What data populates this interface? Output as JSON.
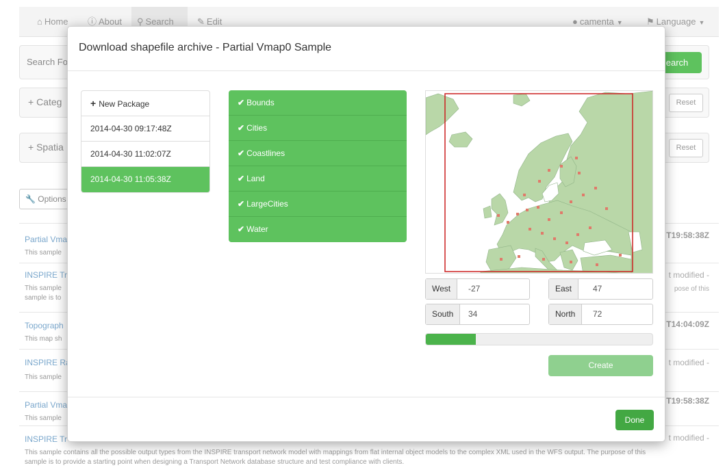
{
  "nav": {
    "home": "Home",
    "about": "About",
    "search": "Search",
    "edit": "Edit",
    "user": "camenta",
    "language": "Language"
  },
  "search": {
    "label": "Search Fo",
    "button": "earch"
  },
  "accordions": [
    {
      "label": "Categ",
      "reset": "Reset"
    },
    {
      "label": "Spatia",
      "reset": "Reset"
    }
  ],
  "options": {
    "label": "Options"
  },
  "results": [
    {
      "title": "Partial Vma",
      "desc": "This sample",
      "meta": "T19:58:38Z"
    },
    {
      "title": "INSPIRE Tr",
      "desc": "This sample\nsample is to",
      "meta": "t modified -",
      "meta2": "pose of this"
    },
    {
      "title": "Topograph",
      "desc": "This map sh",
      "meta": "T14:04:09Z"
    },
    {
      "title": "INSPIRE Ra",
      "desc": "This sample",
      "meta": "t modified -"
    },
    {
      "title": "Partial Vma",
      "desc": "This sample",
      "meta": "T19:58:38Z"
    },
    {
      "title": "INSPIRE Tr",
      "desc": "This sample contains all the possible output types from the INSPIRE transport network model with mappings from flat internal object models to the complex XML used in the WFS output. The purpose of this",
      "desc2": "sample is to provide a starting point when designing a Transport Network database structure and test compliance with clients.",
      "meta": "t modified -"
    }
  ],
  "modal": {
    "title": "Download shapefile archive - Partial Vmap0 Sample",
    "new_package": "New Package",
    "packages": [
      {
        "label": "2014-04-30 09:17:48Z",
        "active": false
      },
      {
        "label": "2014-04-30 11:02:07Z",
        "active": false
      },
      {
        "label": "2014-04-30 11:05:38Z",
        "active": true
      }
    ],
    "layers": [
      "Bounds",
      "Cities",
      "Coastlines",
      "Land",
      "LargeCities",
      "Water"
    ],
    "coords": {
      "west_label": "West",
      "west": "-27",
      "east_label": "East",
      "east": "47",
      "south_label": "South",
      "south": "34",
      "north_label": "North",
      "north": "72"
    },
    "progress": 0.22,
    "create": "Create",
    "done": "Done"
  },
  "colors": {
    "accent": "#5ec25e",
    "land": "#b9d7a8",
    "sea": "#ffffff",
    "bbox": "#cc1f1f",
    "city": "#e07a6a"
  }
}
